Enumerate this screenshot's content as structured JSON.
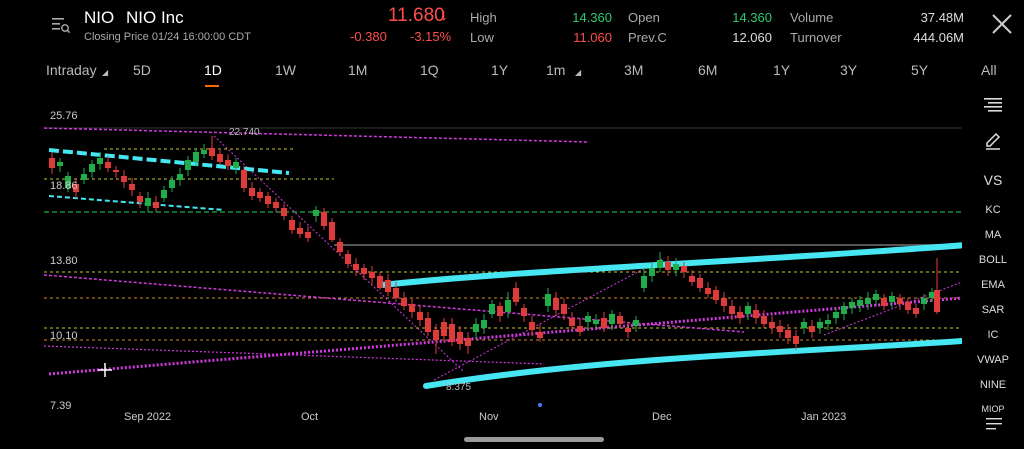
{
  "header": {
    "ticker": "NIO",
    "name": "NIO Inc",
    "closing": "Closing Price  01/24 16:00:00 CDT",
    "price": "11.680",
    "price_arrow": "↓",
    "change": "-0.380",
    "change_pct": "-3.15%",
    "stats": [
      {
        "label": "High",
        "value": "14.360",
        "color": "green"
      },
      {
        "label": "Low",
        "value": "11.060",
        "color": "red"
      },
      {
        "label": "Open",
        "value": "14.360",
        "color": "green"
      },
      {
        "label": "Prev.C",
        "value": "12.060",
        "color": "white"
      },
      {
        "label": "Volume",
        "value": "37.48M",
        "color": "white"
      },
      {
        "label": "Turnover",
        "value": "444.06M",
        "color": "white"
      }
    ]
  },
  "tabs": [
    "Intraday",
    "5D",
    "1D",
    "1W",
    "1M",
    "1Q",
    "1Y",
    "1m",
    "3M",
    "6M",
    "1Y",
    "3Y",
    "5Y",
    "All"
  ],
  "active_tab": "1D",
  "sidebar": {
    "items": [
      "VS",
      "KC",
      "MA",
      "BOLL",
      "EMA",
      "SAR",
      "IC",
      "VWAP",
      "NINE",
      "MIOP"
    ]
  },
  "chart_data": {
    "type": "candlestick",
    "y_labels": [
      "25.76",
      "18.86",
      "13.80",
      "10.10",
      "7.39"
    ],
    "x_labels": [
      "Sep 2022",
      "Oct",
      "Nov",
      "Dec",
      "Jan 2023"
    ],
    "annotations": [
      "22.740",
      "8.375"
    ],
    "ylim": [
      7.39,
      25.76
    ],
    "colors": {
      "up": "#1fae4a",
      "down": "#e03b3b",
      "trend": "#d13adf",
      "channel": "#46e6f2"
    }
  }
}
